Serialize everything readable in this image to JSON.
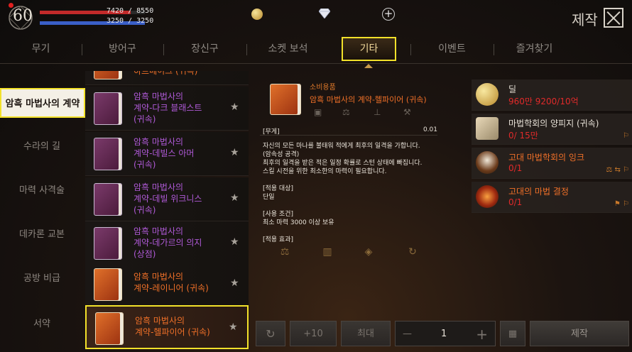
{
  "player": {
    "level": "60",
    "hp_text": "7420 / 8550",
    "hp_fraction": 0.868,
    "mp_text": "3250 / 3250",
    "mp_fraction": 1.0
  },
  "header": {
    "title": "제작"
  },
  "tabs": [
    {
      "label": "무기"
    },
    {
      "label": "방어구"
    },
    {
      "label": "장신구"
    },
    {
      "label": "소켓 보석"
    },
    {
      "label": "기타"
    },
    {
      "label": "이벤트"
    },
    {
      "label": "즐겨찾기"
    }
  ],
  "active_tab": "기타",
  "sidebar": {
    "items": [
      {
        "label": "암흑 마법사의 계약"
      },
      {
        "label": "수라의 길"
      },
      {
        "label": "마력 사격술"
      },
      {
        "label": "데카론 교본"
      },
      {
        "label": "공방 비급"
      },
      {
        "label": "서약"
      }
    ]
  },
  "item_list": {
    "partial_top": "하트베이크 (귀속)",
    "items": [
      {
        "name": "암흑 마법사의 계약-다크 블래스트 (귀속)",
        "lines": [
          "암흑 마법사의",
          "계약-다크 블래스트",
          "(귀속)"
        ],
        "color": "purple"
      },
      {
        "name": "암흑 마법사의 계약-데빌스 아머 (귀속)",
        "lines": [
          "암흑 마법사의",
          "계약-데빌스 아머",
          "(귀속)"
        ],
        "color": "purple"
      },
      {
        "name": "암흑 마법사의 계약-데빌 위크니스 (귀속)",
        "lines": [
          "암흑 마법사의",
          "계약-데빌 위크니스",
          "(귀속)"
        ],
        "color": "purple"
      },
      {
        "name": "암흑 마법사의 계약-데가르의 의지 (상점)",
        "lines": [
          "암흑 마법사의",
          "계약-데가르의 의지",
          "(상점)"
        ],
        "color": "purple"
      },
      {
        "name": "암흑 마법사의 계약-레이니어 (귀속)",
        "lines": [
          "암흑 마법사의",
          "계약-레이니어 (귀속)"
        ],
        "color": "orange"
      },
      {
        "name": "암흑 마법사의 계약-헬파이어 (귀속)",
        "lines": [
          "암흑 마법사의",
          "계약-헬파이어 (귀속)"
        ],
        "color": "orange"
      }
    ]
  },
  "detail": {
    "category": "소비용품",
    "name": "암흑 마법사의 계약-헬파이어 (귀속)",
    "weight_label": "[무게]",
    "weight_value": "0.01",
    "desc": [
      "자신의 모든 마나를 불태워 적에게 최후의 일격을 가합니다.",
      "(암속성 공격)",
      "최후의 일격을 받은 적은 일정 확률로 스턴 상태에 빠집니다.",
      "스킬 시전을 위한 최소한의 마력이 필요합니다."
    ],
    "target_label": "[적용 대상]",
    "target_value": "단일",
    "condition_label": "[사용 조건]",
    "condition_value": "최소 마력 3000 이상 보유",
    "effect_label": "[적용 효과]"
  },
  "materials": [
    {
      "name": "딜",
      "count": "960만 9200/10억",
      "icon": "gold-coin-icon"
    },
    {
      "name": "마법학회의 양피지 (귀속)",
      "count": "0/ 15만",
      "icon": "scroll-icon"
    },
    {
      "name": "고대 마법학회의 잉크",
      "count": "0/1",
      "icon": "ink-icon"
    },
    {
      "name": "고대의 마법 결정",
      "count": "0/1",
      "icon": "crystal-icon"
    }
  ],
  "controls": {
    "plus10_label": "+10",
    "max_label": "최대",
    "minus_label": "—",
    "quantity": "1",
    "plus_label": "+",
    "craft_label": "제작"
  },
  "colors": {
    "highlight": "#f2e12a",
    "hp": "#c22a2a",
    "mp": "#3a5fc8",
    "rare_orange": "#f07028",
    "epic_purple": "#b05ad8",
    "insufficient_red": "#e02a2a"
  }
}
